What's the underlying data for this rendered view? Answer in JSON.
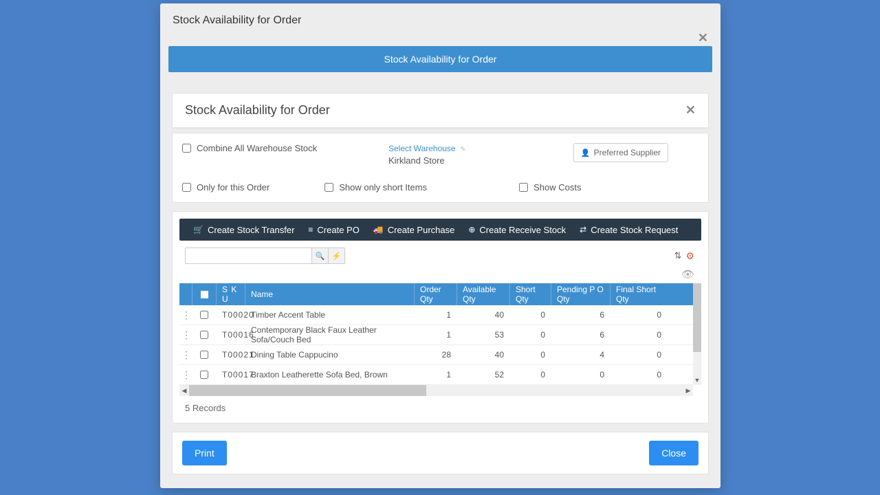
{
  "modal": {
    "title": "Stock Availability for Order",
    "banner": "Stock Availability for Order"
  },
  "panel": {
    "title": "Stock Availability for Order"
  },
  "filters": {
    "combine": "Combine All Warehouse Stock",
    "select_wh_link": "Select Warehouse",
    "warehouse": "Kirkland Store",
    "preferred_supplier": "Preferred Supplier",
    "only_order": "Only for this Order",
    "show_short": "Show only short Items",
    "show_costs": "Show Costs"
  },
  "toolbar": {
    "transfer": "Create Stock Transfer",
    "po": "Create PO",
    "purchase": "Create Purchase",
    "receive": "Create Receive Stock",
    "request": "Create Stock Request"
  },
  "grid": {
    "headers": {
      "sku": "S K U",
      "name": "Name",
      "order_qty": "Order Qty",
      "avail_qty": "Available Qty",
      "short_qty": "Short Qty",
      "pending_po": "Pending P O Qty",
      "final_short": "Final Short Qty"
    },
    "rows": [
      {
        "sku": "T00020",
        "name": "Timber Accent Table",
        "order_qty": "1",
        "avail_qty": "40",
        "short_qty": "0",
        "pending_po": "6",
        "final_short": "0"
      },
      {
        "sku": "T00016",
        "name": "Contemporary Black Faux Leather Sofa/Couch Bed",
        "order_qty": "1",
        "avail_qty": "53",
        "short_qty": "0",
        "pending_po": "6",
        "final_short": "0"
      },
      {
        "sku": "T00021",
        "name": "Dining Table Cappucino",
        "order_qty": "28",
        "avail_qty": "40",
        "short_qty": "0",
        "pending_po": "4",
        "final_short": "0"
      },
      {
        "sku": "T00017",
        "name": "Braxton Leatherette Sofa Bed, Brown",
        "order_qty": "1",
        "avail_qty": "52",
        "short_qty": "0",
        "pending_po": "0",
        "final_short": "0"
      }
    ],
    "count": "5 Records"
  },
  "footer": {
    "print": "Print",
    "close": "Close"
  }
}
